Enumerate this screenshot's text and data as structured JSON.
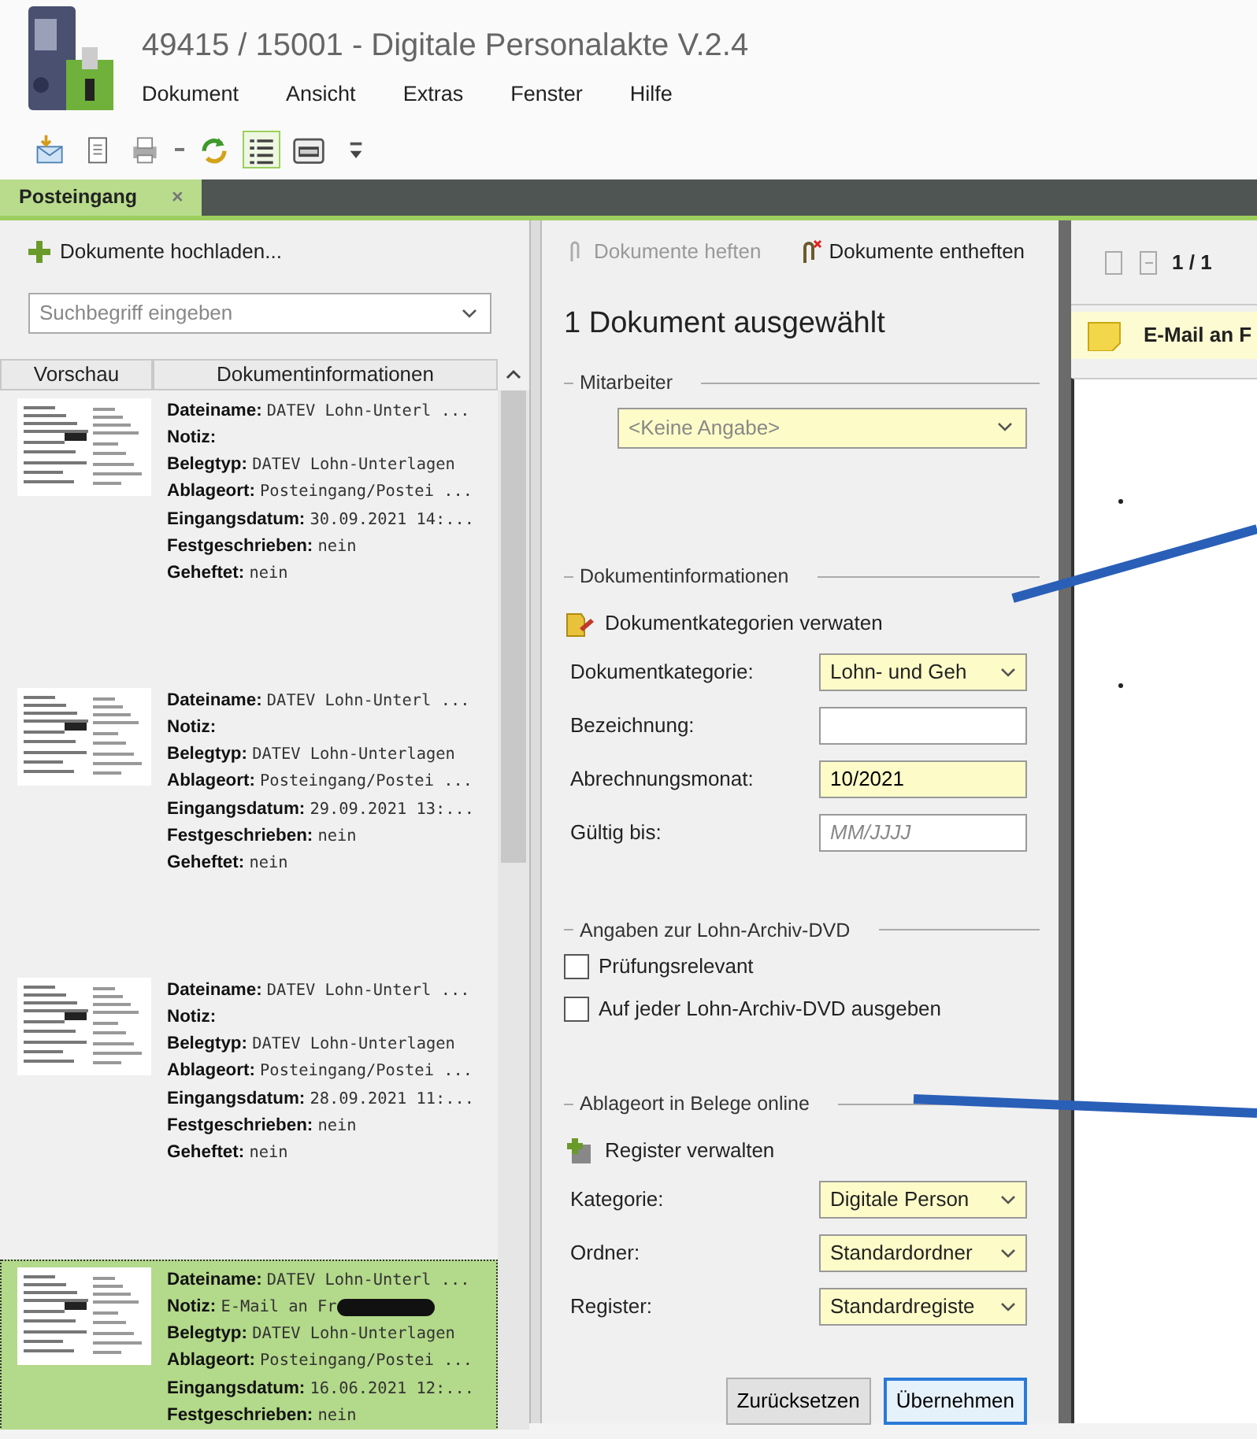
{
  "window": {
    "title": "49415 / 15001 - Digitale Personalakte V.2.4"
  },
  "menu": [
    "Dokument",
    "Ansicht",
    "Extras",
    "Fenster",
    "Hilfe"
  ],
  "toolbar": [
    {
      "kind": "import",
      "pressed": false
    },
    {
      "kind": "document",
      "pressed": false
    },
    {
      "kind": "print",
      "pressed": false
    },
    {
      "kind": "refresh",
      "pressed": false
    },
    {
      "kind": "list",
      "pressed": true
    },
    {
      "kind": "lex",
      "pressed": false
    },
    {
      "kind": "overflow",
      "pressed": false
    }
  ],
  "tabs": [
    {
      "label": "Posteingang",
      "close": "×",
      "selected": true
    }
  ],
  "left": {
    "upload": "Dokumente hochladen...",
    "search": {
      "placeholder": "Suchbegriff eingeben"
    },
    "columns": [
      "Vorschau",
      "Dokumentinformationen"
    ],
    "documents": [
      {
        "selected": false,
        "fields": [
          {
            "label": "Dateiname:",
            "value": "DATEV Lohn-Unterl ..."
          },
          {
            "label": "Notiz:"
          },
          {
            "label": "Belegtyp:",
            "value": "DATEV Lohn-Unterlagen"
          },
          {
            "label": "Ablageort:",
            "value": "Posteingang/Postei ..."
          },
          {
            "label": "Eingangsdatum:",
            "value": "30.09.2021 14:..."
          },
          {
            "label": "Festgeschrieben:",
            "value": "nein"
          },
          {
            "label": "Geheftet:",
            "value": "nein"
          }
        ]
      },
      {
        "selected": false,
        "fields": [
          {
            "label": "Dateiname:",
            "value": "DATEV Lohn-Unterl ..."
          },
          {
            "label": "Notiz:"
          },
          {
            "label": "Belegtyp:",
            "value": "DATEV Lohn-Unterlagen"
          },
          {
            "label": "Ablageort:",
            "value": "Posteingang/Postei ..."
          },
          {
            "label": "Eingangsdatum:",
            "value": "29.09.2021 13:..."
          },
          {
            "label": "Festgeschrieben:",
            "value": "nein"
          },
          {
            "label": "Geheftet:",
            "value": "nein"
          }
        ]
      },
      {
        "selected": false,
        "fields": [
          {
            "label": "Dateiname:",
            "value": "DATEV Lohn-Unterl ..."
          },
          {
            "label": "Notiz:"
          },
          {
            "label": "Belegtyp:",
            "value": "DATEV Lohn-Unterlagen"
          },
          {
            "label": "Ablageort:",
            "value": "Posteingang/Postei ..."
          },
          {
            "label": "Eingangsdatum:",
            "value": "28.09.2021 11:..."
          },
          {
            "label": "Festgeschrieben:",
            "value": "nein"
          },
          {
            "label": "Geheftet:",
            "value": "nein"
          }
        ]
      },
      {
        "selected": true,
        "fields": [
          {
            "label": "Dateiname:",
            "value": "DATEV Lohn-Unterl ..."
          },
          {
            "label": "Notiz:",
            "value": "E-Mail an Fr",
            "redacted": true
          },
          {
            "label": "Belegtyp:",
            "value": "DATEV Lohn-Unterlagen"
          },
          {
            "label": "Ablageort:",
            "value": "Posteingang/Postei ..."
          },
          {
            "label": "Eingangsdatum:",
            "value": "16.06.2021 12:..."
          },
          {
            "label": "Festgeschrieben:",
            "value": "nein"
          }
        ]
      }
    ]
  },
  "middle": {
    "actions": [
      {
        "kind": "staple",
        "label": "Dokumente heften",
        "disabled": true
      },
      {
        "kind": "unstaple",
        "label": "Dokumente entheften",
        "disabled": false
      }
    ],
    "heading": "1 Dokument ausgewählt",
    "groups": [
      {
        "legend": "Mitarbeiter",
        "items": [
          {
            "kind": "combo",
            "value": "<Keine Angabe>",
            "highlighted": true
          }
        ]
      },
      {
        "legend": "Dokumentinformationen",
        "items": [
          {
            "kind": "category_link",
            "label": "Dokumentkategorien verwaten"
          },
          {
            "kind": "select",
            "label": "Dokumentkategorie:",
            "value": "Lohn- und Geh",
            "highlighted": true
          },
          {
            "kind": "input",
            "label": "Bezeichnung:",
            "value": "",
            "highlighted": false
          },
          {
            "kind": "input",
            "label": "Abrechnungsmonat:",
            "value": "10/2021",
            "highlighted": true
          },
          {
            "kind": "input",
            "label": "Gültig bis:",
            "placeholder": "MM/JJJJ",
            "highlighted": false
          }
        ]
      },
      {
        "legend": "Angaben zur Lohn-Archiv-DVD",
        "items": [
          {
            "kind": "checkbox",
            "label": "Prüfungsrelevant",
            "checked": false
          },
          {
            "kind": "checkbox",
            "label": "Auf jeder Lohn-Archiv-DVD ausgeben",
            "checked": false
          }
        ]
      },
      {
        "legend": "Ablageort in Belege online",
        "items": [
          {
            "kind": "register_link",
            "label": "Register verwalten"
          },
          {
            "kind": "select",
            "label": "Kategorie:",
            "value": "Digitale Person",
            "highlighted": true
          },
          {
            "kind": "select",
            "label": "Ordner:",
            "value": "Standardordner",
            "highlighted": true
          },
          {
            "kind": "select",
            "label": "Register:",
            "value": "Standardregiste",
            "highlighted": true
          }
        ]
      }
    ],
    "buttons": [
      {
        "label": "Zurücksetzen",
        "default": false
      },
      {
        "label": "Übernehmen",
        "default": true
      }
    ]
  },
  "viewer": {
    "pager": "1 / 1",
    "note": "E-Mail an F"
  }
}
